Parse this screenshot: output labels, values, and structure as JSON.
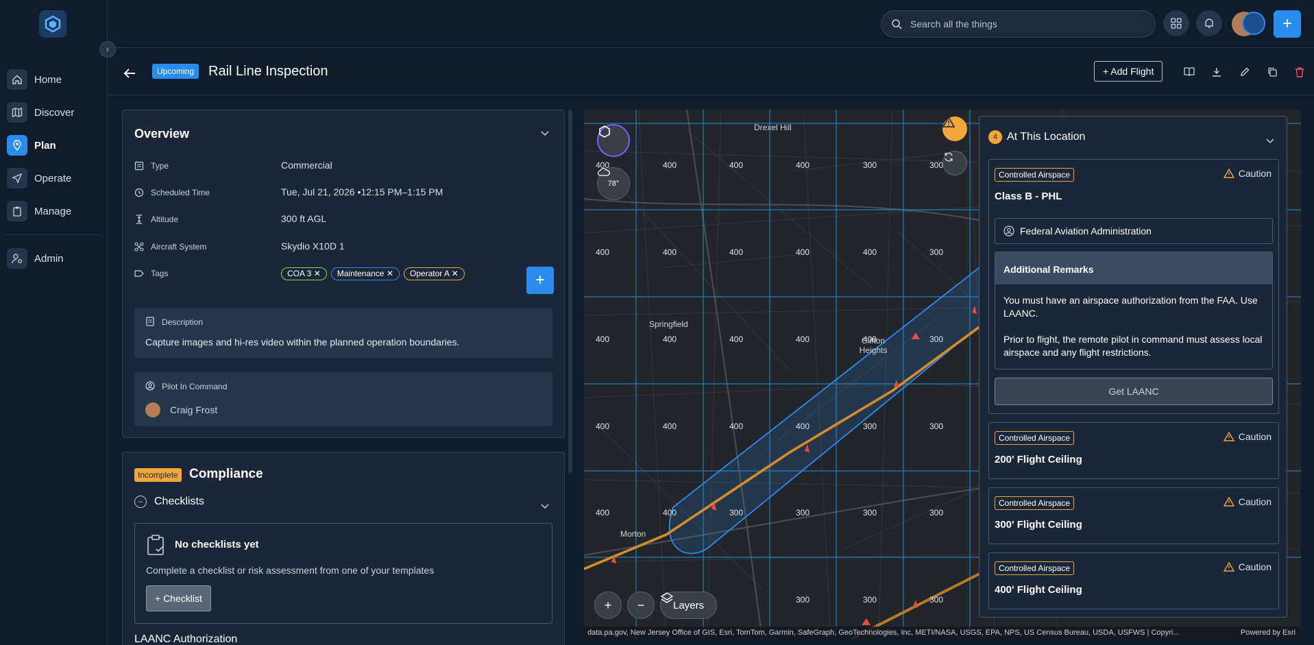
{
  "sidebar": {
    "items": [
      {
        "label": "Home",
        "icon": "home-icon"
      },
      {
        "label": "Discover",
        "icon": "map-icon"
      },
      {
        "label": "Plan",
        "icon": "location-pin-icon"
      },
      {
        "label": "Operate",
        "icon": "send-icon"
      },
      {
        "label": "Manage",
        "icon": "clipboard-icon"
      },
      {
        "label": "Admin",
        "icon": "user-cog-icon"
      }
    ],
    "active": "Plan"
  },
  "topbar": {
    "search_placeholder": "Search all the things",
    "new_button": "+"
  },
  "header": {
    "status_badge": "Upcoming",
    "title": "Rail Line Inspection",
    "add_flight": "+ Add Flight"
  },
  "overview": {
    "title": "Overview",
    "rows": [
      {
        "label": "Type",
        "value": "Commercial"
      },
      {
        "label": "Scheduled Time",
        "value": "Tue, Jul 21, 2026 •12:15 PM–1:15 PM"
      },
      {
        "label": "Altitude",
        "value": "300 ft AGL"
      },
      {
        "label": "Aircraft System",
        "value": "Skydio X10D 1"
      },
      {
        "label": "Tags",
        "value": ""
      }
    ],
    "tags": [
      "COA 3",
      "Maintenance",
      "Operator A"
    ],
    "tag_remove": "✕",
    "add_tag": "+",
    "description_label": "Description",
    "description": "Capture images and hi-res video within the planned operation boundaries.",
    "pic_label": "Pilot In Command",
    "pic_name": "Craig Frost"
  },
  "compliance": {
    "status_badge": "Incomplete",
    "title": "Compliance",
    "checklists_label": "Checklists",
    "empty_title": "No checklists yet",
    "empty_text": "Complete a checklist or risk assessment from one of your templates",
    "add_checklist": "+ Checklist",
    "next_section": "LAANC Authorization"
  },
  "map": {
    "weather_temp": "78°",
    "layers_label": "Layers",
    "zoom_in": "+",
    "zoom_out": "−",
    "places": [
      "Drexel Hill",
      "Springfield",
      "Clifton Heights",
      "Morton"
    ],
    "grid_values": [
      "400",
      "300"
    ],
    "attribution": "data.pa.gov, New Jersey Office of GIS, Esri, TomTom, Garmin, SafeGraph, GeoTechnologies, Inc, METI/NASA, USGS, EPA, NPS, US Census Bureau, USDA, USFWS | Copyri...",
    "powered_by": "Powered by Esri"
  },
  "at_location": {
    "count": "4",
    "title": "At This Location",
    "cards": [
      {
        "badge": "Controlled Airspace",
        "status": "Caution",
        "title": "Class B - PHL",
        "authority": "Federal Aviation Administration",
        "remarks_title": "Additional Remarks",
        "remarks_1": "You must have an airspace authorization from the FAA. Use LAANC.",
        "remarks_2": "Prior to flight, the remote pilot in command must assess local airspace and any flight restrictions.",
        "action": "Get LAANC"
      },
      {
        "badge": "Controlled Airspace",
        "status": "Caution",
        "title": "200' Flight Ceiling"
      },
      {
        "badge": "Controlled Airspace",
        "status": "Caution",
        "title": "300' Flight Ceiling"
      },
      {
        "badge": "Controlled Airspace",
        "status": "Caution",
        "title": "400' Flight Ceiling"
      }
    ]
  },
  "colors": {
    "accent": "#2b8cf0",
    "warning": "#f3a63b",
    "background": "#0f1c2c",
    "panel": "#1a2738"
  }
}
